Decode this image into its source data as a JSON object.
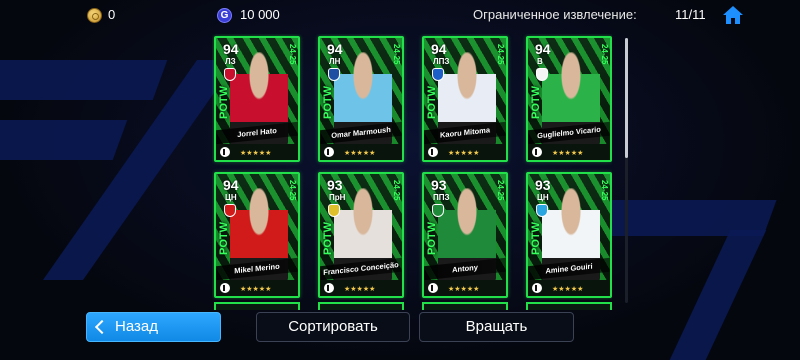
{
  "currency": {
    "gold_icon": "gold-coin-icon",
    "gold_amount": "0",
    "gcoin_icon": "g-coin-icon",
    "gcoin_symbol": "G",
    "gcoin_amount": "10 000"
  },
  "limit": {
    "label": "Ограниченное извлечение:",
    "count": "11/11"
  },
  "home_icon": "home-icon",
  "colors": {
    "card_border": "#22e04a",
    "accent_green": "#35ff5c",
    "back_button": "#1a97f5",
    "star": "#f1c84b"
  },
  "cards": [
    {
      "rating": "94",
      "position": "ЛЗ",
      "name": "Jorrel Hato",
      "season": "24-25",
      "tag": "POTW",
      "stars": "★★★★★",
      "kit": "#c8102e",
      "crest": "#c8102e"
    },
    {
      "rating": "94",
      "position": "ЛН",
      "name": "Omar Marmoush",
      "season": "24-25",
      "tag": "POTW",
      "stars": "★★★★★",
      "kit": "#6ec3e8",
      "crest": "#1e4fa3"
    },
    {
      "rating": "94",
      "position": "ЛПЗ",
      "name": "Kaoru Mitoma",
      "season": "24-25",
      "tag": "POTW",
      "stars": "★★★★★",
      "kit": "#e8edf5",
      "crest": "#1d5fc9"
    },
    {
      "rating": "94",
      "position": "В",
      "name": "Guglielmo Vicario",
      "season": "24-25",
      "tag": "POTW",
      "stars": "★★★★★",
      "kit": "#2bb34a",
      "crest": "#f5f5f5"
    },
    {
      "rating": "94",
      "position": "ЦН",
      "name": "Mikel Merino",
      "season": "24-25",
      "tag": "POTW",
      "stars": "★★★★★",
      "kit": "#d11a1a",
      "crest": "#d11a1a"
    },
    {
      "rating": "93",
      "position": "ПрН",
      "name": "Francisco Conceição",
      "season": "24-25",
      "tag": "POTW",
      "stars": "★★★★★",
      "kit": "#e6e0dc",
      "crest": "#e0c02a"
    },
    {
      "rating": "93",
      "position": "ППЗ",
      "name": "Antony",
      "season": "24-25",
      "tag": "POTW",
      "stars": "★★★★★",
      "kit": "#1f8a3a",
      "crest": "#1f8a3a"
    },
    {
      "rating": "93",
      "position": "ЦН",
      "name": "Amine Gouiri",
      "season": "24-25",
      "tag": "POTW",
      "stars": "★★★★★",
      "kit": "#f2f5f8",
      "crest": "#2aa6e0"
    }
  ],
  "buttons": {
    "back": "Назад",
    "sort": "Сортировать",
    "rotate": "Вращать"
  }
}
